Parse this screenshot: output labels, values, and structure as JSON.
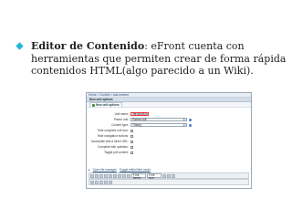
{
  "slide": {
    "bullet_title": "Editor de Contenido",
    "bullet_text": ": eFront cuenta con herramientas que permiten crear de forma rápida contenidos HTML(algo parecido a un Wiki)."
  },
  "screenshot": {
    "breadcrumb": "Home > Content > Add content",
    "panel_title": "New unit options",
    "tab_label": "New unit options",
    "fields": [
      {
        "label": "Unit name:",
        "value": "Introduction",
        "type": "text"
      },
      {
        "label": "Parent unit:",
        "value": "Parent unit",
        "type": "select"
      },
      {
        "label": "Content type:",
        "value": "Theory",
        "type": "select"
      },
      {
        "label": "Hide complete unit icon:",
        "type": "checkbox"
      },
      {
        "label": "Hide navigation buttons:",
        "type": "checkbox"
      },
      {
        "label": "Accessible with a direct URL:",
        "type": "checkbox"
      },
      {
        "label": "Complete with question:",
        "type": "checkbox"
      },
      {
        "label": "Toggle pdf content:",
        "type": "checkbox"
      }
    ],
    "editor": {
      "open_manager": "Open file manager",
      "toggle_editor": "Toggle editor/html mode",
      "font_family": "Font family",
      "font_size": "Font size"
    }
  }
}
